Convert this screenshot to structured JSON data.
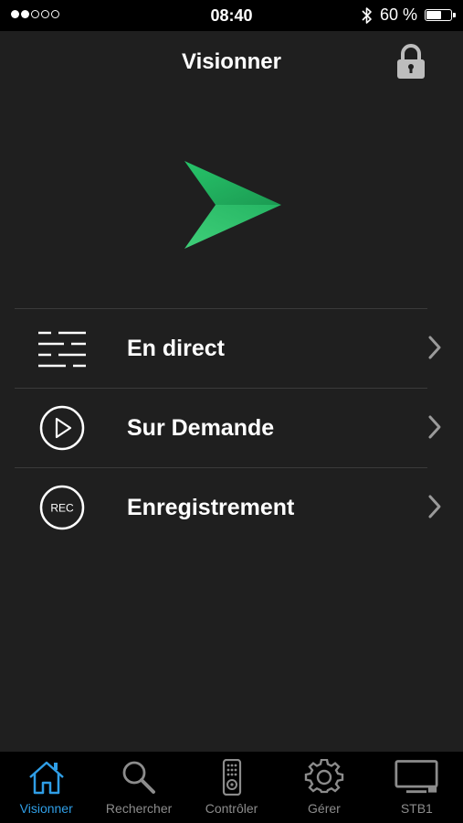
{
  "status_bar": {
    "time": "08:40",
    "battery_text": "60 %",
    "battery_level": 0.6,
    "signal_bars_filled": 2,
    "signal_bars_total": 5
  },
  "header": {
    "title": "Visionner"
  },
  "menu": {
    "items": [
      {
        "label": "En direct",
        "icon": "list-lines-icon"
      },
      {
        "label": "Sur Demande",
        "icon": "play-circle-icon"
      },
      {
        "label": "Enregistrement",
        "icon": "rec-icon",
        "icon_text": "REC"
      }
    ]
  },
  "tabs": [
    {
      "label": "Visionner",
      "icon": "home-icon",
      "active": true
    },
    {
      "label": "Rechercher",
      "icon": "search-icon",
      "active": false
    },
    {
      "label": "Contrôler",
      "icon": "remote-icon",
      "active": false
    },
    {
      "label": "Gérer",
      "icon": "gear-icon",
      "active": false
    },
    {
      "label": "STB1",
      "icon": "tv-icon",
      "active": false
    }
  ],
  "colors": {
    "background": "#1f1f1f",
    "accent": "#2f9ee6",
    "logo_green": "#1fa85a",
    "inactive": "#8c8c8c"
  }
}
